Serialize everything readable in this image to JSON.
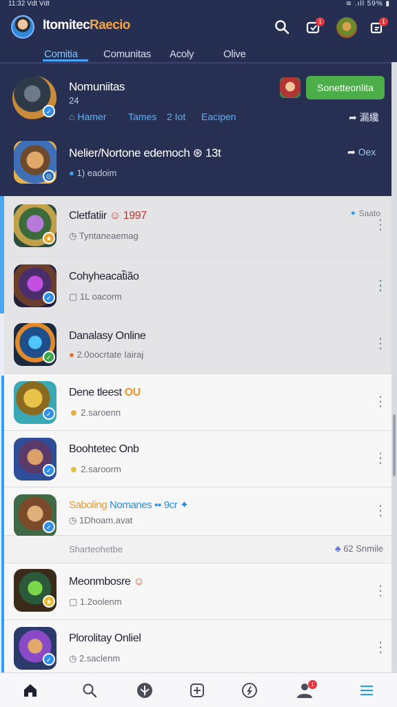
{
  "status_bar": {
    "time": "11:32 Vdt Vdt",
    "system": "≋ .ıll 59% ▮"
  },
  "header": {
    "title_main": "Itomitec",
    "title_accent": "Raecio",
    "search_icon": "search-icon",
    "notif_badge": "1",
    "share_badge": "1"
  },
  "tabs": [
    {
      "label": "Comitia",
      "active": true
    },
    {
      "label": "Comunitas",
      "active": false
    },
    {
      "label": "Acoly",
      "active": false
    },
    {
      "label": "Olive",
      "active": false
    }
  ],
  "featured": {
    "title": "Nomuniitas",
    "count": "24",
    "links": [
      "Hamer",
      "Tames",
      "2 Iot",
      "Eacipen"
    ],
    "cta_label": "Sonetteonlita",
    "share_label": "漏纔"
  },
  "featured2": {
    "title": "Nelier/Nortone edemoch",
    "title_suffix": "⊛ 13t",
    "meta": "1) eadoim",
    "share_label": "Oex"
  },
  "list": [
    {
      "title": "Cletfatiir",
      "suffix": "1997",
      "meta": "Tyntaneaemag",
      "right": "Saato",
      "kebab_green": false
    },
    {
      "title": "Cohyheacat̃ião",
      "suffix": "",
      "meta": "1L oacorm",
      "right": "",
      "kebab_green": true
    },
    {
      "title": "Danalasy Online",
      "suffix": "",
      "meta": "2.0oocrtate Iairaj",
      "right": "",
      "kebab_green": false
    },
    {
      "title": "Dene tleest",
      "suffix": "OU",
      "meta": "2.saroenn",
      "right": "",
      "kebab_green": false
    },
    {
      "title": "Boohtetec Onb",
      "suffix": "",
      "meta": "2.saroorm",
      "right": "",
      "kebab_green": false
    },
    {
      "title": "Saboling",
      "suffix": "Nomanes ▪▪ 9cr",
      "meta": "1Dhoam.avat",
      "right": "",
      "kebab_green": false
    }
  ],
  "section": {
    "label": "Sharteohetbe",
    "right": "62 Snmile"
  },
  "list2": [
    {
      "title": "Meonmbosre",
      "meta": "1.2oolenm"
    },
    {
      "title": "Plorolitay Onliel",
      "meta": "2.saclenm"
    }
  ],
  "bottom_nav": {
    "profile_badge": "1"
  }
}
